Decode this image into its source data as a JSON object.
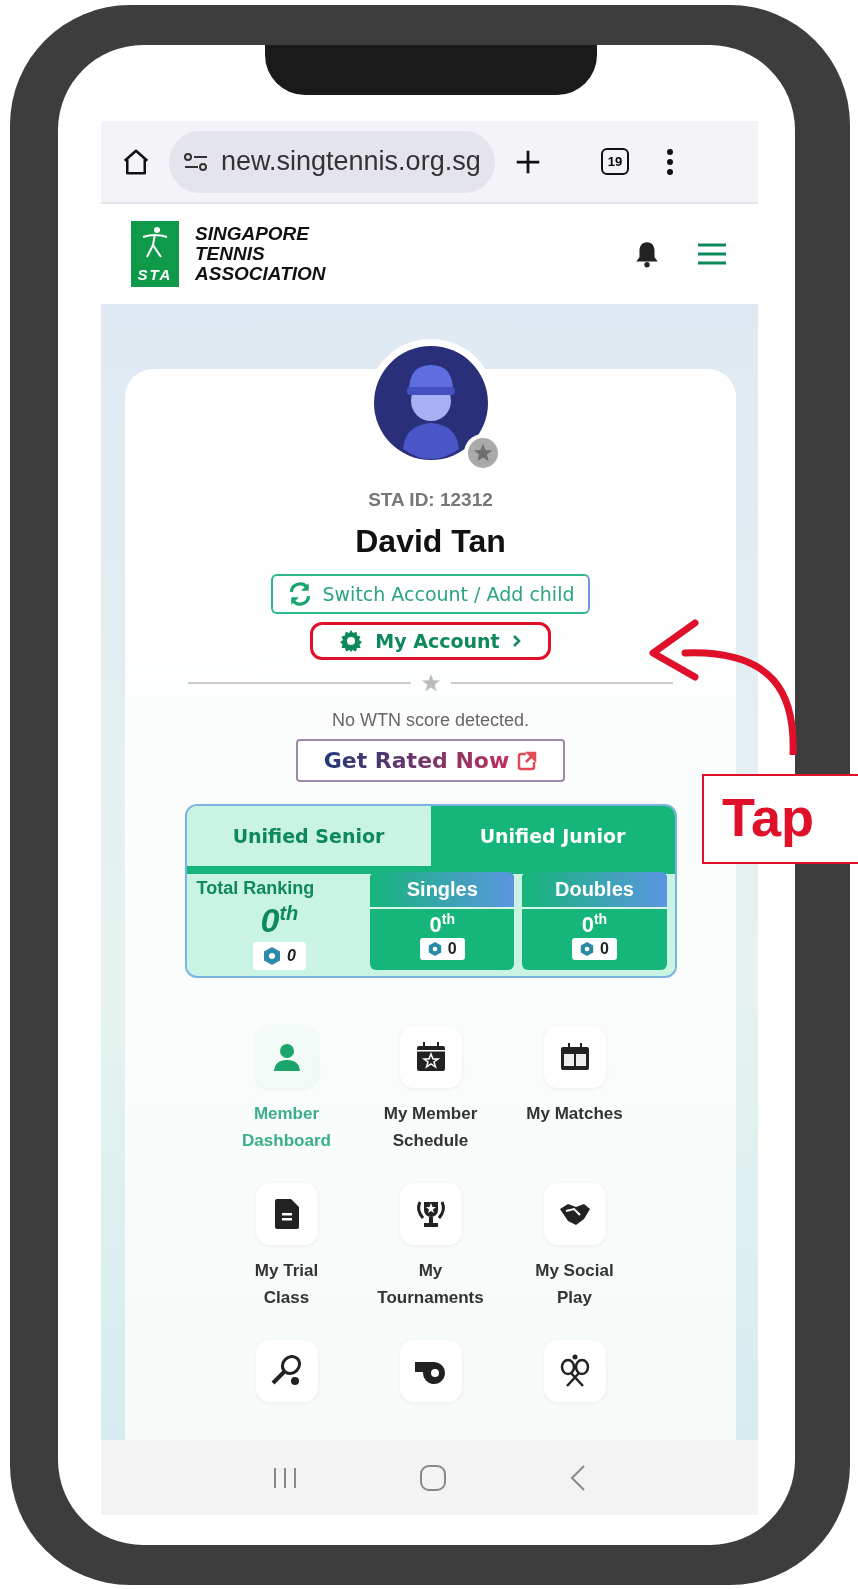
{
  "browser": {
    "url": "new.singtennis.org.sg",
    "tab_count": "19"
  },
  "header": {
    "logo_text": "STA",
    "org_name": [
      "SINGAPORE",
      "TENNIS",
      "ASSOCIATION"
    ]
  },
  "profile": {
    "sta_id": "STA ID: 12312",
    "name": "David Tan",
    "switch_button": "Switch Account / Add child",
    "account_button": "My Account"
  },
  "wtn": {
    "message": "No WTN score detected.",
    "button": "Get Rated Now"
  },
  "ranking": {
    "tabs": [
      {
        "label": "Unified Senior",
        "selected": true
      },
      {
        "label": "Unified Junior",
        "selected": false
      }
    ],
    "total": {
      "label": "Total Ranking",
      "rank": "0$^{th}$",
      "points": "0"
    },
    "categories": [
      {
        "label": "Singles",
        "rank": "0$^{th}$",
        "points": "0"
      },
      {
        "label": "Doubles",
        "rank": "0$^{th}$",
        "points": "0"
      }
    ]
  },
  "menu": [
    {
      "label": [
        "Member",
        "Dashboard"
      ],
      "selected": true
    },
    {
      "label": [
        "My Member",
        "Schedule"
      ],
      "selected": false
    },
    {
      "label": [
        "My Matches"
      ],
      "selected": false
    },
    {
      "label": [
        "My Trial",
        "Class"
      ],
      "selected": false
    },
    {
      "label": [
        "My",
        "Tournaments"
      ],
      "selected": false
    },
    {
      "label": [
        "My Social",
        "Play"
      ],
      "selected": false
    },
    {
      "selected": false
    },
    {
      "selected": false
    },
    {
      "selected": false
    }
  ],
  "annotation": {
    "text": "Tap"
  }
}
